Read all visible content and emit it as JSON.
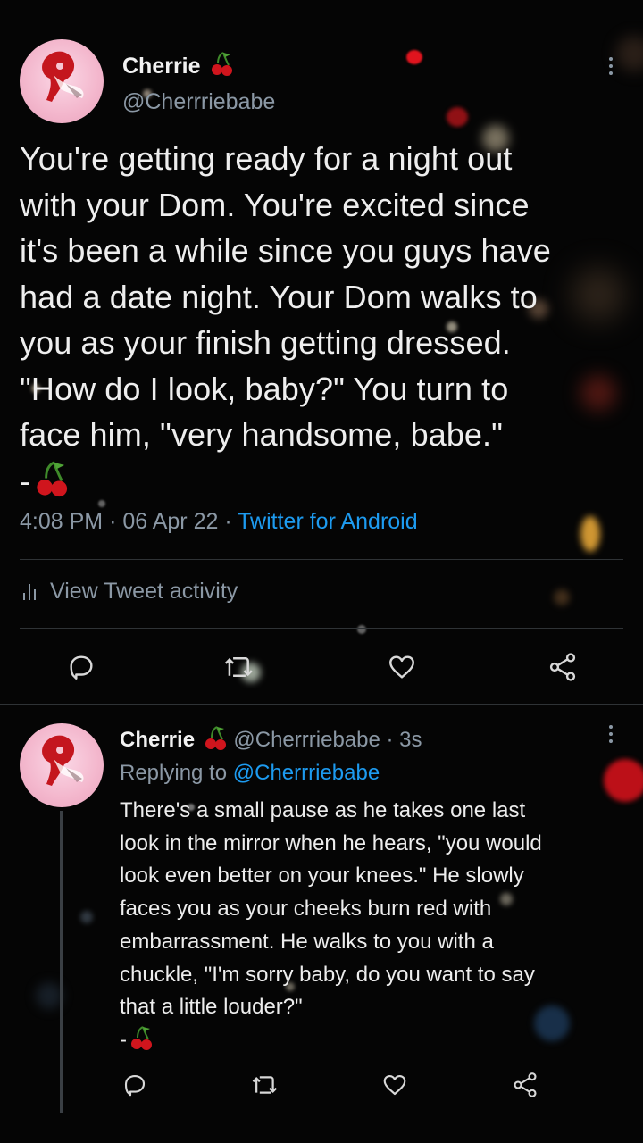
{
  "main_tweet": {
    "author_name": "Cherrie",
    "author_handle": "@Cherrriebabe",
    "text": "You're getting ready for a night out\nwith your Dom. You're excited since\nit's been a while since you guys have\nhad a date night. Your Dom walks to\nyou as your finish getting dressed.\n\"How do I look, baby?\" You turn to\nface him, \"very handsome, babe.\"\n-",
    "time": "4:08 PM",
    "date": "06 Apr 22",
    "source": "Twitter for Android",
    "sep": "·",
    "activity_label": "View Tweet activity"
  },
  "reply_tweet": {
    "author_name": "Cherrie",
    "author_handle": "@Cherrriebabe",
    "age": "3s",
    "sep": "·",
    "replying_prefix": "Replying to",
    "replying_handle": "@Cherrriebabe",
    "text": "There's a small pause as he takes one last\nlook in the mirror when he hears, \"you would\nlook even better on your knees.\" He slowly\nfaces you as your cheeks burn red with\nembarrassment. He walks to you with a\nchuckle, \"I'm sorry baby, do you want to say\nthat a little louder?\"\n-"
  },
  "icons": {
    "reply": "reply-icon",
    "retweet": "retweet-icon",
    "like": "heart-icon",
    "share": "share-icon",
    "more": "more-icon",
    "cherry": "cherry-emoji-icon",
    "activity": "bar-chart-icon"
  },
  "colors": {
    "background": "#050505",
    "text": "#e7e9ea",
    "secondary": "#8b98a5",
    "link": "#1d9bf0",
    "cherry": "#d0151d"
  }
}
